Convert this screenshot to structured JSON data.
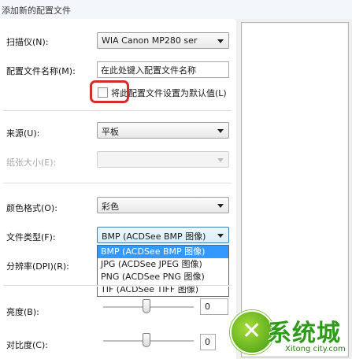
{
  "window": {
    "title": "添加新的配置文件"
  },
  "form": {
    "scanner": {
      "label": "扫描仪(N):",
      "value": "WIA Canon MP280 ser"
    },
    "profile_name": {
      "label": "配置文件名称(M):",
      "value": "在此处键入配置文件名称"
    },
    "default_checkbox": {
      "label": "将此配置文件设置为默认值(L)",
      "checked": false
    },
    "source": {
      "label": "来源(U):",
      "value": "平板"
    },
    "paper_size": {
      "label": "纸张大小(E):",
      "value": ""
    },
    "color_format": {
      "label": "颜色格式(O):",
      "value": "彩色"
    },
    "file_type": {
      "label": "文件类型(F):",
      "value": "BMP (ACDSee BMP 图像)",
      "options": [
        "BMP (ACDSee BMP 图像)",
        "JPG (ACDSee JPEG 图像)",
        "PNG (ACDSee PNG 图像)",
        "TIF (ACDSee TIFF 图像)"
      ],
      "selected_index": 0
    },
    "resolution": {
      "label": "分辨率(DPI)(R):"
    },
    "brightness": {
      "label": "亮度(B):",
      "value": "0"
    },
    "contrast": {
      "label": "对比度(C):",
      "value": "0"
    }
  },
  "watermark": {
    "brand": "系统城",
    "url": "Xitong city.com",
    "logo_icon": "shield-x-logo"
  },
  "colors": {
    "highlight": "#d42b2b",
    "selection": "#3399ff",
    "watermark_green": "#2e9a1a"
  }
}
